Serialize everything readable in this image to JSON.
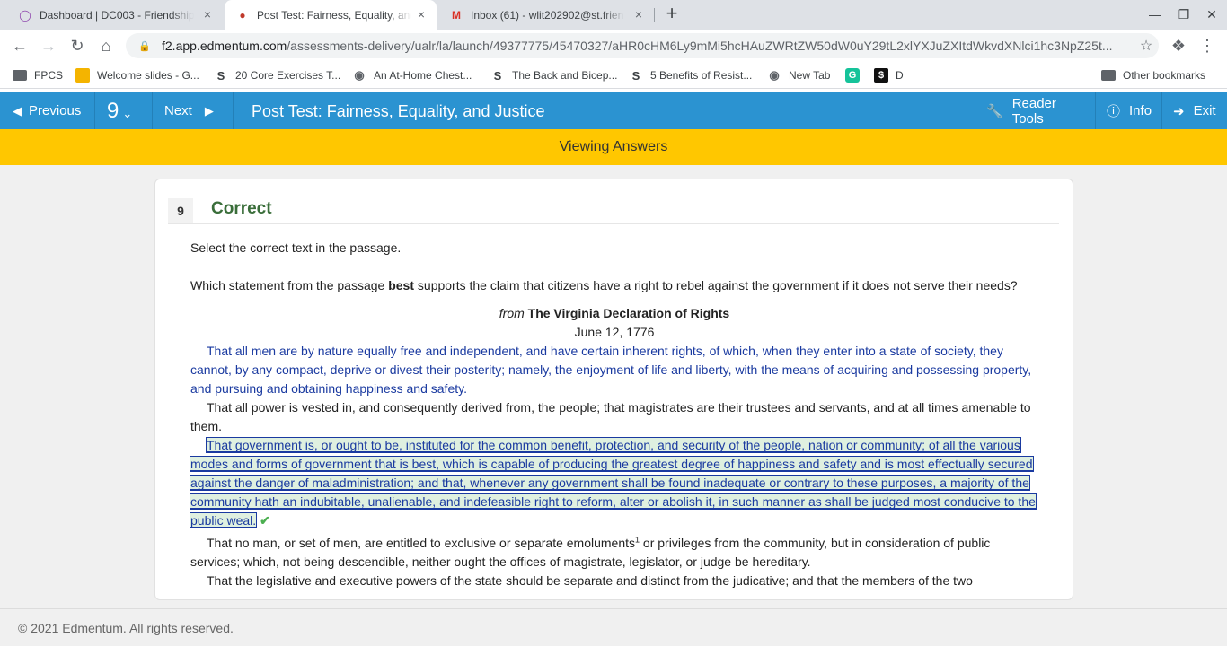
{
  "browser": {
    "tabs": [
      {
        "title": "Dashboard | DC003 - Friendship",
        "icon": "lightbulb-icon"
      },
      {
        "title": "Post Test: Fairness, Equality, and",
        "icon": "edmentum-icon"
      },
      {
        "title": "Inbox (61) - wlit202902@st.frien",
        "icon": "gmail-icon"
      }
    ],
    "url_host": "f2.app.edmentum.com",
    "url_path": "/assessments-delivery/ualr/la/launch/49377775/45470327/aHR0cHM6Ly9mMi5hcHAuZWRtZW50dW0uY29tL2xlYXJuZXItdWkvdXNlci1hc3NpZ25t...",
    "bookmarks": [
      {
        "label": "FPCS",
        "icon": "folder-icon"
      },
      {
        "label": "Welcome slides - G...",
        "icon": "slides-icon"
      },
      {
        "label": "20 Core Exercises T...",
        "icon": "s-icon"
      },
      {
        "label": "An At-Home Chest...",
        "icon": "globe-icon"
      },
      {
        "label": "The Back and Bicep...",
        "icon": "s-icon"
      },
      {
        "label": "5 Benefits of Resist...",
        "icon": "s-icon"
      },
      {
        "label": "New Tab",
        "icon": "globe-icon"
      },
      {
        "label": "",
        "icon": "grammarly-icon"
      },
      {
        "label": "D",
        "icon": "dollar-icon"
      }
    ],
    "other_bookmarks": "Other bookmarks"
  },
  "app": {
    "previous": "Previous",
    "question_number": "9",
    "next": "Next",
    "title": "Post Test: Fairness, Equality, and Justice",
    "reader_tools": "Reader Tools",
    "info": "Info",
    "exit": "Exit",
    "banner": "Viewing Answers"
  },
  "question": {
    "number": "9",
    "status": "Correct",
    "instruction": "Select the correct text in the passage.",
    "prompt_pre": "Which statement from the passage ",
    "prompt_bold": "best",
    "prompt_post": " supports the claim that citizens have a right to rebel against the government if it does not serve their needs?",
    "source_from": "from",
    "source_title": "The Virginia Declaration of Rights",
    "source_date": "June 12, 1776",
    "para1": "That all men are by nature equally free and independent, and have certain inherent rights, of which, when they enter into a state of society, they cannot, by any compact, deprive or divest their posterity; namely, the enjoyment of life and liberty, with the means of acquiring and possessing property, and pursuing and obtaining happiness and safety.",
    "para2": "That all power is vested in, and consequently derived from, the people; that magistrates are their trustees and servants, and at all times amenable to them.",
    "para3_selected": "That government is, or ought to be, instituted for the common benefit, protection, and security of the people, nation or community; of all the various modes and forms of government that is best, which is capable of producing the greatest degree of happiness and safety and is most effectually secured against the danger of maladministration; and that, whenever any government shall be found inadequate or contrary to these purposes, a majority of the community hath an indubitable, unalienable, and indefeasible right to reform, alter or abolish it, in such manner as shall be judged most conducive to the public weal.",
    "para4_pre": "That no man, or set of men, are entitled to exclusive or separate emoluments",
    "para4_sup": "1",
    "para4_post": " or privileges from the community, but in consideration of public services; which, not being descendible, neither ought the offices of magistrate, legislator, or judge be hereditary.",
    "para5_partial": "That the legislative and executive powers of the state should be separate and distinct from the judicative; and that the members of the two"
  },
  "footer": "© 2021 Edmentum. All rights reserved."
}
